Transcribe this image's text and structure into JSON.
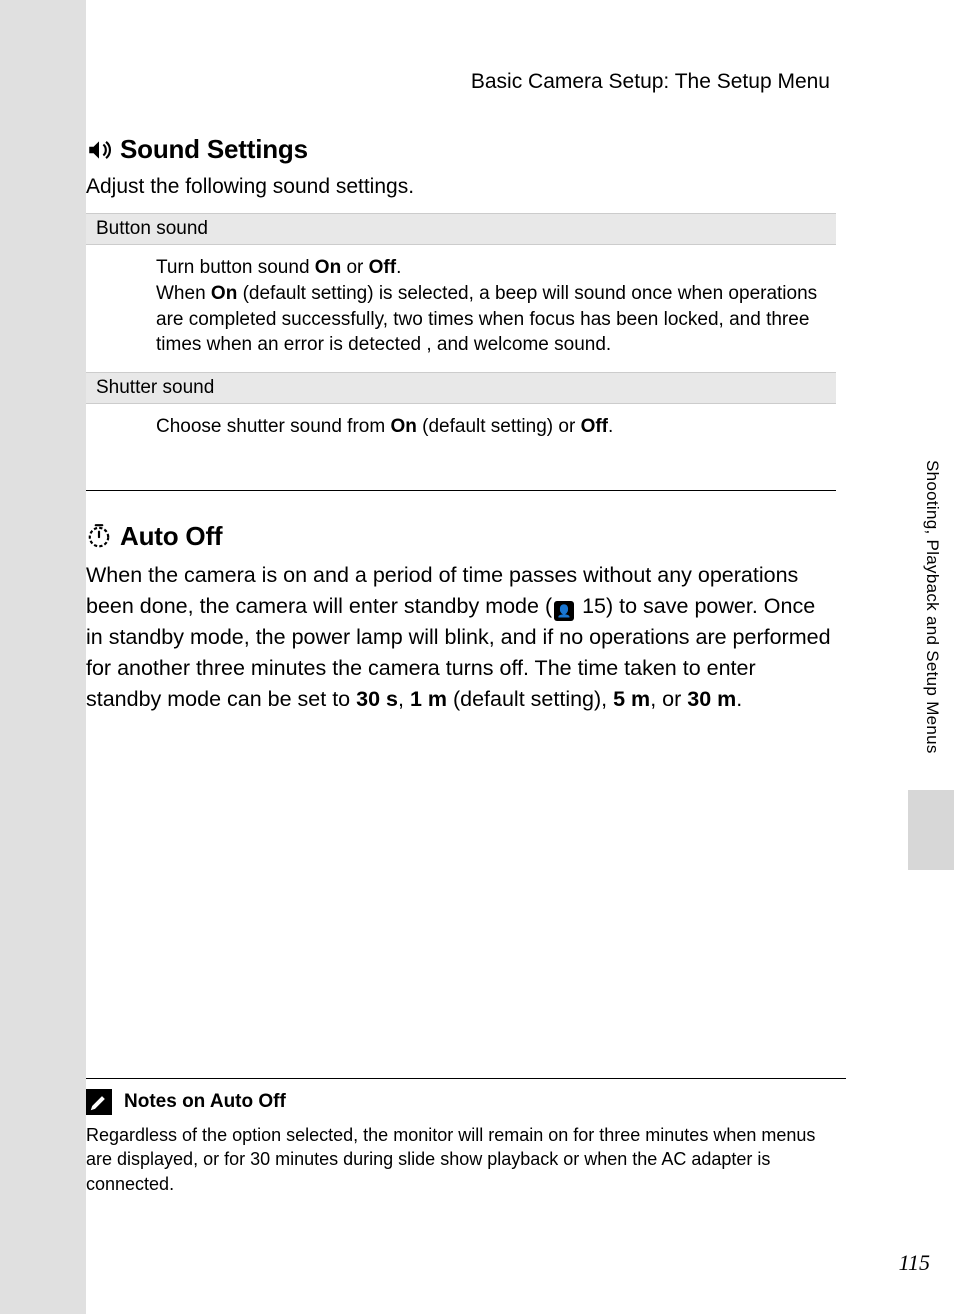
{
  "breadcrumb": "Basic Camera Setup: The Setup Menu",
  "side_label": "Shooting, Playback and Setup Menus",
  "page_number": "115",
  "sound": {
    "heading": "Sound Settings",
    "intro": "Adjust the following sound settings.",
    "rows": [
      {
        "label": "Button sound",
        "body_pre": "Turn button sound ",
        "on": "On",
        "or": " or ",
        "off": "Off",
        "body_post": ".",
        "line2_pre": "When ",
        "line2_on": "On",
        "line2_post": " (default setting) is selected, a beep will sound once when operations are completed successfully, two times when focus has been locked, and three times when an error is detected , and welcome sound."
      },
      {
        "label": "Shutter sound",
        "body_pre": "Choose shutter sound from ",
        "on": "On",
        "mid": " (default setting) or ",
        "off": "Off",
        "body_post": "."
      }
    ]
  },
  "auto_off": {
    "heading": "Auto Off",
    "p1_a": "When the camera is on and a period of time passes without any operations been done, the camera will enter standby mode (",
    "ref": "15",
    "p1_b": ") to save power. Once in standby mode, the power lamp will blink, and if no operations are performed for another three minutes the camera turns off. The time taken to enter standby mode can be set to ",
    "opt1": "30 s",
    "sep1": ", ",
    "opt2": "1 m",
    "opt2_note": " (default setting), ",
    "opt3": "5 m",
    "sep2": ", or ",
    "opt4": "30 m",
    "tail": "."
  },
  "notes": {
    "title": "Notes on Auto Off",
    "body": "Regardless of the option selected, the monitor will remain on for three minutes when menus are displayed, or for 30 minutes during slide show playback or when the AC adapter is connected."
  }
}
